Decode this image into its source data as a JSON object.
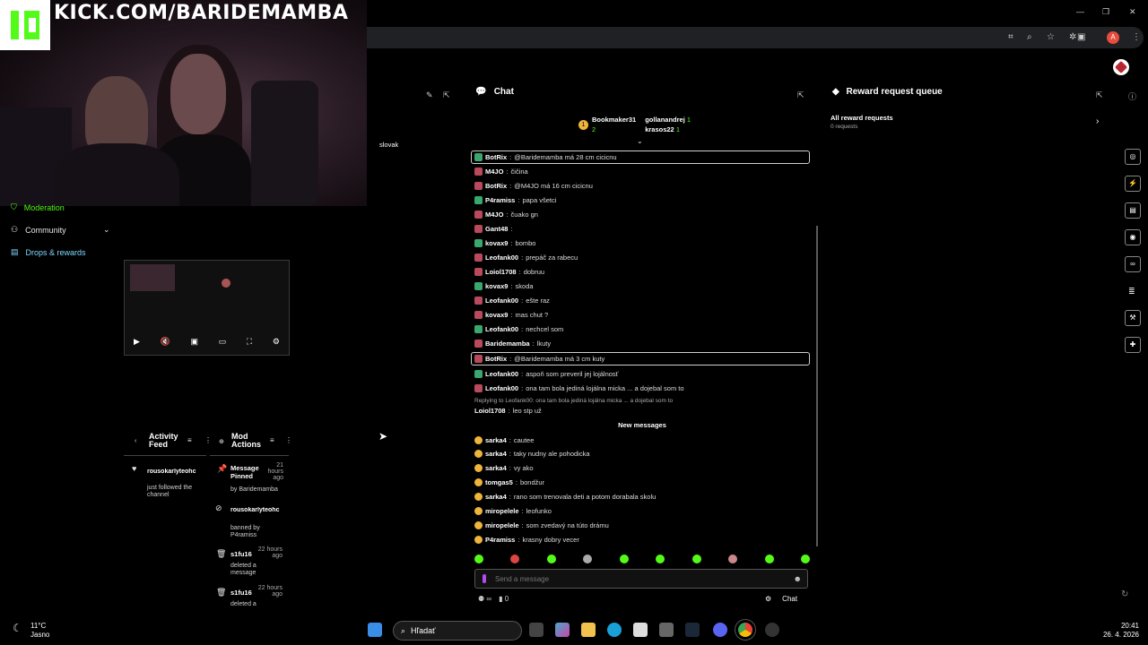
{
  "overlay": {
    "channel_url": "KICK.COM/BARIDEMAMBA"
  },
  "browser": {
    "profile_initial": "A"
  },
  "sidebar": {
    "language": "slovak",
    "items": [
      {
        "label": "Moderation"
      },
      {
        "label": "Community"
      },
      {
        "label": "Drops & rewards"
      }
    ]
  },
  "feeds": {
    "activity_title": "Activity Feed",
    "mod_title": "Mod Actions",
    "activity": [
      {
        "name": "rousokarlyteohc",
        "text": "just followed the channel"
      }
    ],
    "mod": [
      {
        "title": "Message Pinned",
        "by": "by Baridemamba",
        "time": "21 hours ago"
      },
      {
        "name": "rousokarlyteohc",
        "text": "banned by P4ramiss"
      },
      {
        "name": "s1fu16",
        "text": "deleted a message",
        "time": "22 hours ago"
      },
      {
        "name": "s1fu16",
        "text": "deleted a",
        "time": "22 hours ago"
      }
    ]
  },
  "chat": {
    "title": "Chat",
    "leaders": [
      {
        "rank": "1",
        "name": "Bookmaker31",
        "count": "2"
      },
      {
        "name": "gollanandrej",
        "count": "1"
      },
      {
        "name": "krasos22",
        "count": "1"
      }
    ],
    "messages": [
      {
        "user": "BotRix",
        "text": "@Baridemamba má 28 cm cicicnu",
        "pinned": true
      },
      {
        "user": "M4JO",
        "text": "čičina"
      },
      {
        "user": "BotRix",
        "text": "@M4JO má 16 cm cicicnu"
      },
      {
        "user": "P4ramiss",
        "text": "papa všetci"
      },
      {
        "user": "M4JO",
        "text": "čuako gn"
      },
      {
        "user": "Gant48",
        "text": ""
      },
      {
        "user": "kovax9",
        "text": "bombo"
      },
      {
        "user": "Leofank00",
        "text": "prepáč za rabecu"
      },
      {
        "user": "Loiol1708",
        "text": "dobruu"
      },
      {
        "user": "kovax9",
        "text": "skoda"
      },
      {
        "user": "Leofank00",
        "text": "ešte raz"
      },
      {
        "user": "kovax9",
        "text": "mas chut ?"
      },
      {
        "user": "Leofank00",
        "text": "nechcel som"
      },
      {
        "user": "Baridemamba",
        "text": "lkuty"
      },
      {
        "user": "BotRix",
        "text": "@Baridemamba má 3 cm kuty",
        "pinned": true
      },
      {
        "user": "Leofank00",
        "text": "aspoň som preveril jej lojálnosť"
      },
      {
        "user": "Leofank00",
        "text": "ona tam bola jediná lojálna micka ... a dojebal som to"
      }
    ],
    "reply_note": "Replying to Leofank00: ona tam bola jediná lojálna micka ... a dojebal som to",
    "reply_msg": {
      "user": "Loiol1708",
      "text": "leo stp už"
    },
    "new_messages_label": "New messages",
    "new_messages": [
      {
        "user": "sarka4",
        "text": "cautee"
      },
      {
        "user": "sarka4",
        "text": "taky nudny ale pohodicka"
      },
      {
        "user": "sarka4",
        "text": "vy ako"
      },
      {
        "user": "tomgas5",
        "text": "bondžur"
      },
      {
        "user": "sarka4",
        "text": "rano som trenovala deti a potom dorabala skolu"
      },
      {
        "user": "miropelele",
        "text": "leofunko"
      },
      {
        "user": "miropelele",
        "text": "som zvedavý na túto drámu"
      },
      {
        "user": "P4ramiss",
        "text": "krasny dobry vecer"
      }
    ],
    "input_placeholder": "Send a message",
    "footer_count": "0",
    "send_label": "Chat"
  },
  "reward": {
    "title": "Reward request queue",
    "subtitle": "All reward requests",
    "count": "0 requests"
  },
  "taskbar": {
    "search_placeholder": "Hľadať",
    "time": "20:41",
    "date": "26. 4. 2026",
    "temperature": "11°C",
    "weather": "Jasno"
  },
  "colors": {
    "accent": "#53fc18",
    "background": "#000000"
  }
}
